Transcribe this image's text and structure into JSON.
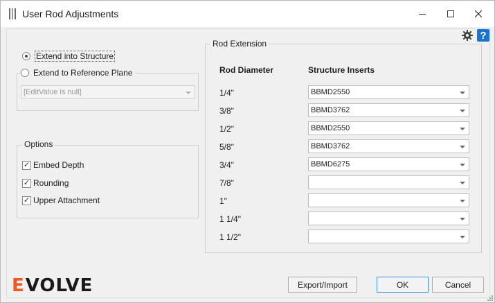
{
  "window": {
    "title": "User Rod Adjustments"
  },
  "placement": {
    "extend_structure_label": "Extend into Structure",
    "extend_plane_label": "Extend to Reference Plane",
    "plane_combo_value": "[EditValue is null]",
    "extend_structure_selected": true
  },
  "options": {
    "legend": "Options",
    "items": [
      {
        "label": "Embed Depth",
        "checked": true
      },
      {
        "label": "Rounding",
        "checked": true
      },
      {
        "label": "Upper Attachment",
        "checked": true
      }
    ]
  },
  "rod_extension": {
    "legend": "Rod Extension",
    "col_diameter": "Rod Diameter",
    "col_inserts": "Structure Inserts",
    "rows": [
      {
        "diameter": "1/4\"",
        "insert": "BBMD2550"
      },
      {
        "diameter": "3/8\"",
        "insert": "BBMD3762"
      },
      {
        "diameter": "1/2\"",
        "insert": "BBMD2550"
      },
      {
        "diameter": "5/8\"",
        "insert": "BBMD3762"
      },
      {
        "diameter": "3/4\"",
        "insert": "BBMD6275"
      },
      {
        "diameter": "7/8\"",
        "insert": ""
      },
      {
        "diameter": "1\"",
        "insert": ""
      },
      {
        "diameter": "1 1/4\"",
        "insert": ""
      },
      {
        "diameter": "1 1/2\"",
        "insert": ""
      }
    ]
  },
  "buttons": {
    "export_import": "Export/Import",
    "ok": "OK",
    "cancel": "Cancel"
  },
  "logo": {
    "text_e": "E",
    "text_rest": "VOLVE"
  },
  "icons": {
    "app": "rod-icon",
    "settings": "gear-icon",
    "help": "help-icon",
    "minimize": "minimize-icon",
    "maximize": "maximize-icon",
    "close": "close-icon"
  },
  "colors": {
    "accent": "#1b75d0",
    "logo_accent": "#f05a22",
    "ok_border": "#3d8ee0"
  }
}
